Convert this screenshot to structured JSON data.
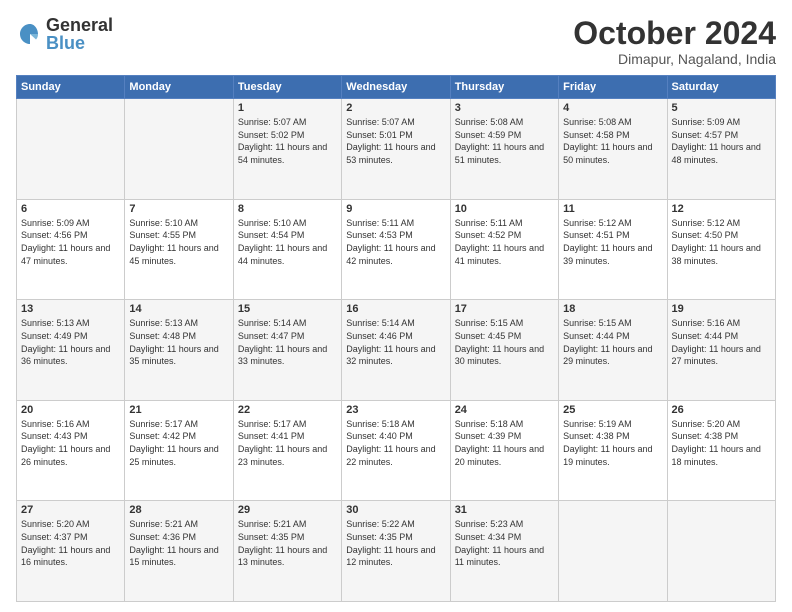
{
  "header": {
    "logo_general": "General",
    "logo_blue": "Blue",
    "month_title": "October 2024",
    "subtitle": "Dimapur, Nagaland, India"
  },
  "days_of_week": [
    "Sunday",
    "Monday",
    "Tuesday",
    "Wednesday",
    "Thursday",
    "Friday",
    "Saturday"
  ],
  "weeks": [
    [
      {
        "day": "",
        "info": ""
      },
      {
        "day": "",
        "info": ""
      },
      {
        "day": "1",
        "info": "Sunrise: 5:07 AM\nSunset: 5:02 PM\nDaylight: 11 hours and 54 minutes."
      },
      {
        "day": "2",
        "info": "Sunrise: 5:07 AM\nSunset: 5:01 PM\nDaylight: 11 hours and 53 minutes."
      },
      {
        "day": "3",
        "info": "Sunrise: 5:08 AM\nSunset: 4:59 PM\nDaylight: 11 hours and 51 minutes."
      },
      {
        "day": "4",
        "info": "Sunrise: 5:08 AM\nSunset: 4:58 PM\nDaylight: 11 hours and 50 minutes."
      },
      {
        "day": "5",
        "info": "Sunrise: 5:09 AM\nSunset: 4:57 PM\nDaylight: 11 hours and 48 minutes."
      }
    ],
    [
      {
        "day": "6",
        "info": "Sunrise: 5:09 AM\nSunset: 4:56 PM\nDaylight: 11 hours and 47 minutes."
      },
      {
        "day": "7",
        "info": "Sunrise: 5:10 AM\nSunset: 4:55 PM\nDaylight: 11 hours and 45 minutes."
      },
      {
        "day": "8",
        "info": "Sunrise: 5:10 AM\nSunset: 4:54 PM\nDaylight: 11 hours and 44 minutes."
      },
      {
        "day": "9",
        "info": "Sunrise: 5:11 AM\nSunset: 4:53 PM\nDaylight: 11 hours and 42 minutes."
      },
      {
        "day": "10",
        "info": "Sunrise: 5:11 AM\nSunset: 4:52 PM\nDaylight: 11 hours and 41 minutes."
      },
      {
        "day": "11",
        "info": "Sunrise: 5:12 AM\nSunset: 4:51 PM\nDaylight: 11 hours and 39 minutes."
      },
      {
        "day": "12",
        "info": "Sunrise: 5:12 AM\nSunset: 4:50 PM\nDaylight: 11 hours and 38 minutes."
      }
    ],
    [
      {
        "day": "13",
        "info": "Sunrise: 5:13 AM\nSunset: 4:49 PM\nDaylight: 11 hours and 36 minutes."
      },
      {
        "day": "14",
        "info": "Sunrise: 5:13 AM\nSunset: 4:48 PM\nDaylight: 11 hours and 35 minutes."
      },
      {
        "day": "15",
        "info": "Sunrise: 5:14 AM\nSunset: 4:47 PM\nDaylight: 11 hours and 33 minutes."
      },
      {
        "day": "16",
        "info": "Sunrise: 5:14 AM\nSunset: 4:46 PM\nDaylight: 11 hours and 32 minutes."
      },
      {
        "day": "17",
        "info": "Sunrise: 5:15 AM\nSunset: 4:45 PM\nDaylight: 11 hours and 30 minutes."
      },
      {
        "day": "18",
        "info": "Sunrise: 5:15 AM\nSunset: 4:44 PM\nDaylight: 11 hours and 29 minutes."
      },
      {
        "day": "19",
        "info": "Sunrise: 5:16 AM\nSunset: 4:44 PM\nDaylight: 11 hours and 27 minutes."
      }
    ],
    [
      {
        "day": "20",
        "info": "Sunrise: 5:16 AM\nSunset: 4:43 PM\nDaylight: 11 hours and 26 minutes."
      },
      {
        "day": "21",
        "info": "Sunrise: 5:17 AM\nSunset: 4:42 PM\nDaylight: 11 hours and 25 minutes."
      },
      {
        "day": "22",
        "info": "Sunrise: 5:17 AM\nSunset: 4:41 PM\nDaylight: 11 hours and 23 minutes."
      },
      {
        "day": "23",
        "info": "Sunrise: 5:18 AM\nSunset: 4:40 PM\nDaylight: 11 hours and 22 minutes."
      },
      {
        "day": "24",
        "info": "Sunrise: 5:18 AM\nSunset: 4:39 PM\nDaylight: 11 hours and 20 minutes."
      },
      {
        "day": "25",
        "info": "Sunrise: 5:19 AM\nSunset: 4:38 PM\nDaylight: 11 hours and 19 minutes."
      },
      {
        "day": "26",
        "info": "Sunrise: 5:20 AM\nSunset: 4:38 PM\nDaylight: 11 hours and 18 minutes."
      }
    ],
    [
      {
        "day": "27",
        "info": "Sunrise: 5:20 AM\nSunset: 4:37 PM\nDaylight: 11 hours and 16 minutes."
      },
      {
        "day": "28",
        "info": "Sunrise: 5:21 AM\nSunset: 4:36 PM\nDaylight: 11 hours and 15 minutes."
      },
      {
        "day": "29",
        "info": "Sunrise: 5:21 AM\nSunset: 4:35 PM\nDaylight: 11 hours and 13 minutes."
      },
      {
        "day": "30",
        "info": "Sunrise: 5:22 AM\nSunset: 4:35 PM\nDaylight: 11 hours and 12 minutes."
      },
      {
        "day": "31",
        "info": "Sunrise: 5:23 AM\nSunset: 4:34 PM\nDaylight: 11 hours and 11 minutes."
      },
      {
        "day": "",
        "info": ""
      },
      {
        "day": "",
        "info": ""
      }
    ]
  ]
}
